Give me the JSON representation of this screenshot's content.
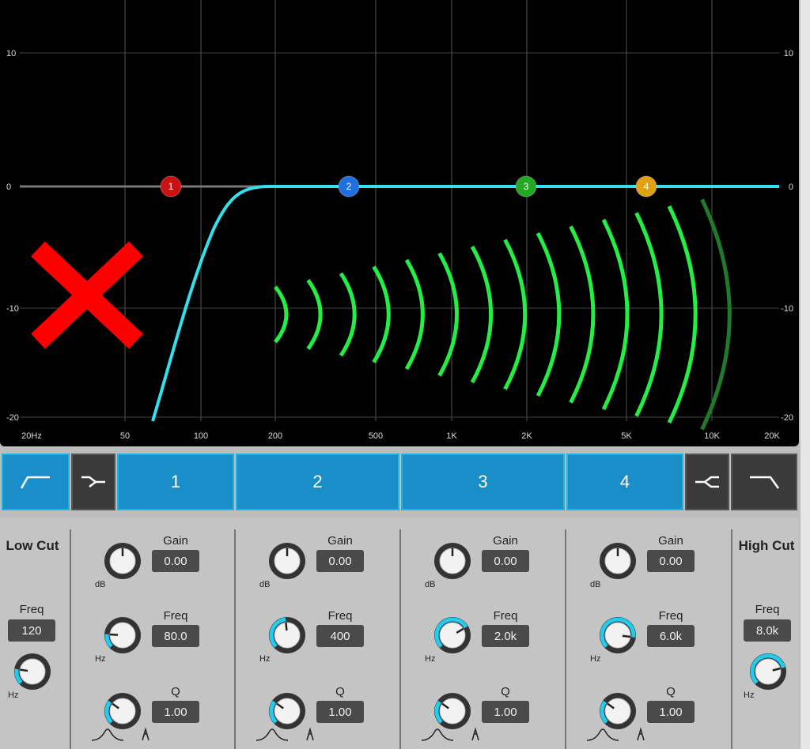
{
  "graph": {
    "y_ticks_left": [
      "10",
      "0",
      "-10",
      "-20"
    ],
    "y_ticks_right": [
      "10",
      "0",
      "-10",
      "-20"
    ],
    "x_ticks": [
      "20Hz",
      "50",
      "100",
      "200",
      "500",
      "1K",
      "2K",
      "5K",
      "10K",
      "20K"
    ],
    "nodes": [
      "1",
      "2",
      "3",
      "4"
    ],
    "node_colors": [
      "#cc1111",
      "#1f6fe0",
      "#22a822",
      "#e0a010"
    ],
    "curve_color": "#33e0ee",
    "wave_color": "#22ee44",
    "disabled_icon": "red-x-icon"
  },
  "tabs": {
    "low_cut_icon": "low-cut-icon",
    "low_shelf_icon": "low-shelf-icon",
    "bands": [
      "1",
      "2",
      "3",
      "4"
    ],
    "high_shelf_icon": "high-shelf-icon",
    "high_cut_icon": "high-cut-icon"
  },
  "low_cut": {
    "title": "Low Cut",
    "freq_label": "Freq",
    "freq_value": "120",
    "unit": "Hz"
  },
  "high_cut": {
    "title": "High Cut",
    "freq_label": "Freq",
    "freq_value": "8.0k",
    "unit": "Hz"
  },
  "bands": [
    {
      "gain_label": "Gain",
      "gain": "0.00",
      "gain_unit": "dB",
      "freq_label": "Freq",
      "freq": "80.0",
      "freq_unit": "Hz",
      "q_label": "Q",
      "q": "1.00"
    },
    {
      "gain_label": "Gain",
      "gain": "0.00",
      "gain_unit": "dB",
      "freq_label": "Freq",
      "freq": "400",
      "freq_unit": "Hz",
      "q_label": "Q",
      "q": "1.00"
    },
    {
      "gain_label": "Gain",
      "gain": "0.00",
      "gain_unit": "dB",
      "freq_label": "Freq",
      "freq": "2.0k",
      "freq_unit": "Hz",
      "q_label": "Q",
      "q": "1.00"
    },
    {
      "gain_label": "Gain",
      "gain": "0.00",
      "gain_unit": "dB",
      "freq_label": "Freq",
      "freq": "6.0k",
      "freq_unit": "Hz",
      "q_label": "Q",
      "q": "1.00"
    }
  ]
}
